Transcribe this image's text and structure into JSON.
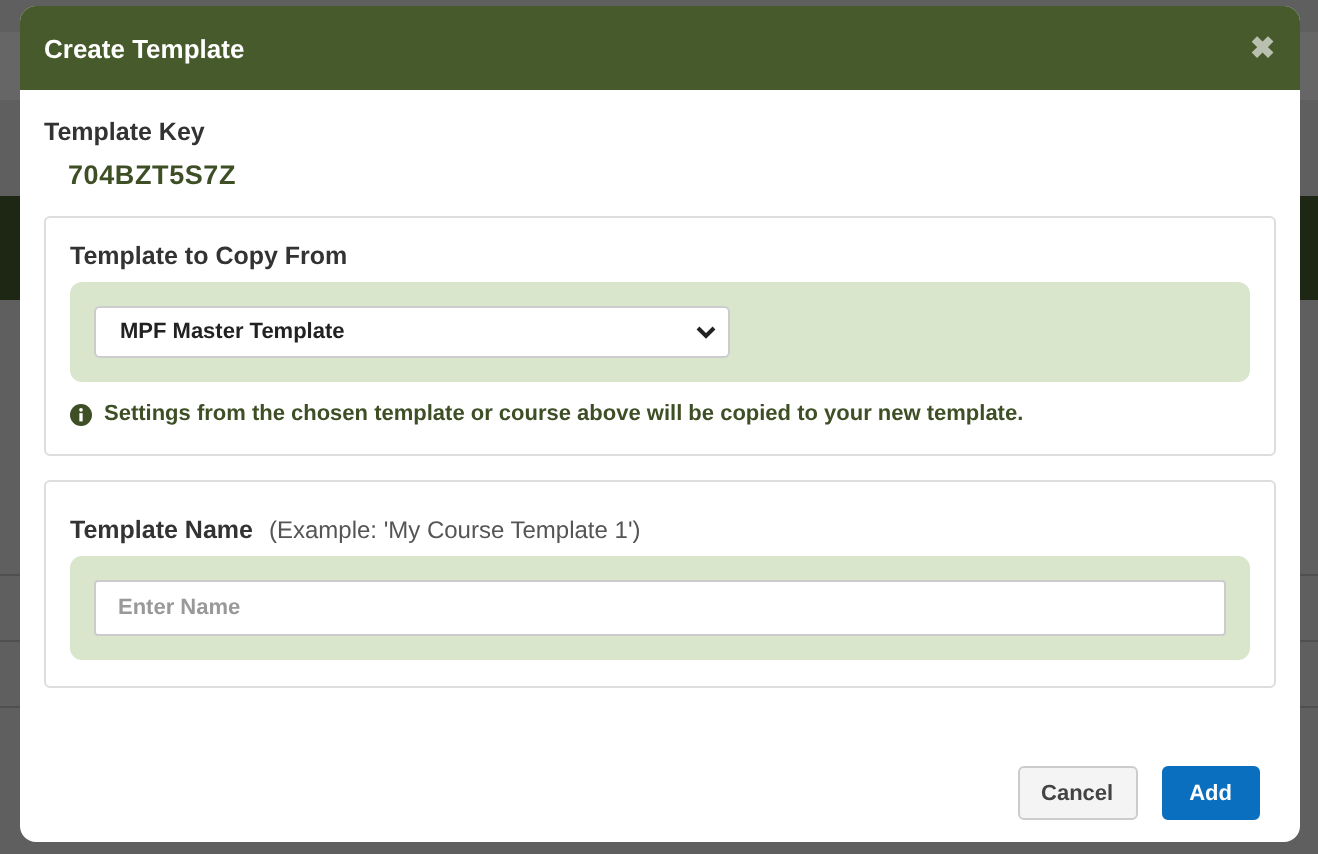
{
  "dialog": {
    "title": "Create Template",
    "close_icon": "✖"
  },
  "template_key": {
    "label": "Template Key",
    "value": "704BZT5S7Z"
  },
  "copy_from": {
    "label": "Template to Copy From",
    "value": "MPF Master Template",
    "info": "Settings from the chosen template or course above will be copied to your new template."
  },
  "template_name": {
    "label": "Template Name",
    "hint": "(Example: 'My Course Template 1')",
    "placeholder": "Enter Name"
  },
  "buttons": [
    {
      "label": "Cancel",
      "kind": "secondary"
    },
    {
      "label": "Add",
      "kind": "primary"
    }
  ]
}
